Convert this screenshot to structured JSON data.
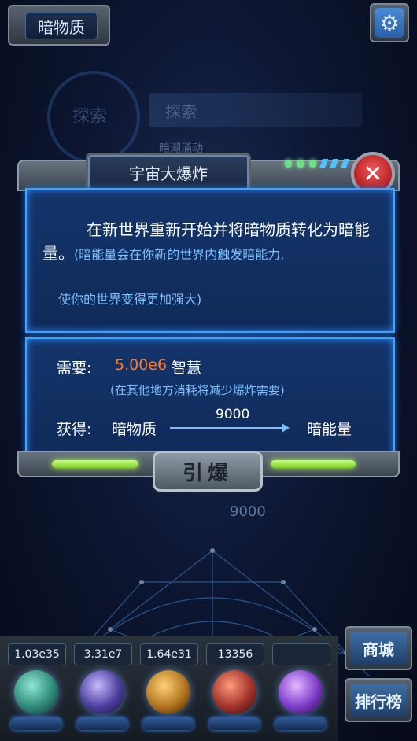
{
  "top": {
    "resource_tab_label": "暗物质",
    "settings_icon": "gear-icon"
  },
  "background": {
    "explore_ring_label": "探索",
    "explore_bar_label": "探索",
    "explore_sub_label": "暗潮涌动",
    "value_9000": "9000"
  },
  "dialog": {
    "title": "宇宙大爆炸",
    "close_icon": "close-x-icon",
    "description_main": "在新世界重新开始并将暗物质转化为暗能量。",
    "description_note_1": "(暗能量会在你新的世界内触发暗能力,",
    "description_note_2": "使你的世界变得更加强大)",
    "requirement": {
      "label": "需要:",
      "value": "5.00e6",
      "unit": "智慧",
      "note": "(在其他地方消耗将减少爆炸需要)"
    },
    "gain": {
      "label": "获得:",
      "from": "暗物质",
      "amount": "9000",
      "to": "暗能量"
    },
    "detonate_button": "引爆"
  },
  "resources": [
    {
      "value": "1.03e35",
      "orb_color": "#2f8a7a"
    },
    {
      "value": "3.31e7",
      "orb_color": "#4c3f9e"
    },
    {
      "value": "1.64e31",
      "orb_color": "#b2741e"
    },
    {
      "value": "13356",
      "orb_color": "#a0322a"
    },
    {
      "value": "",
      "orb_color": "#7d3cc8"
    }
  ],
  "side_buttons": {
    "shop": "商城",
    "leaderboard": "排行榜"
  }
}
